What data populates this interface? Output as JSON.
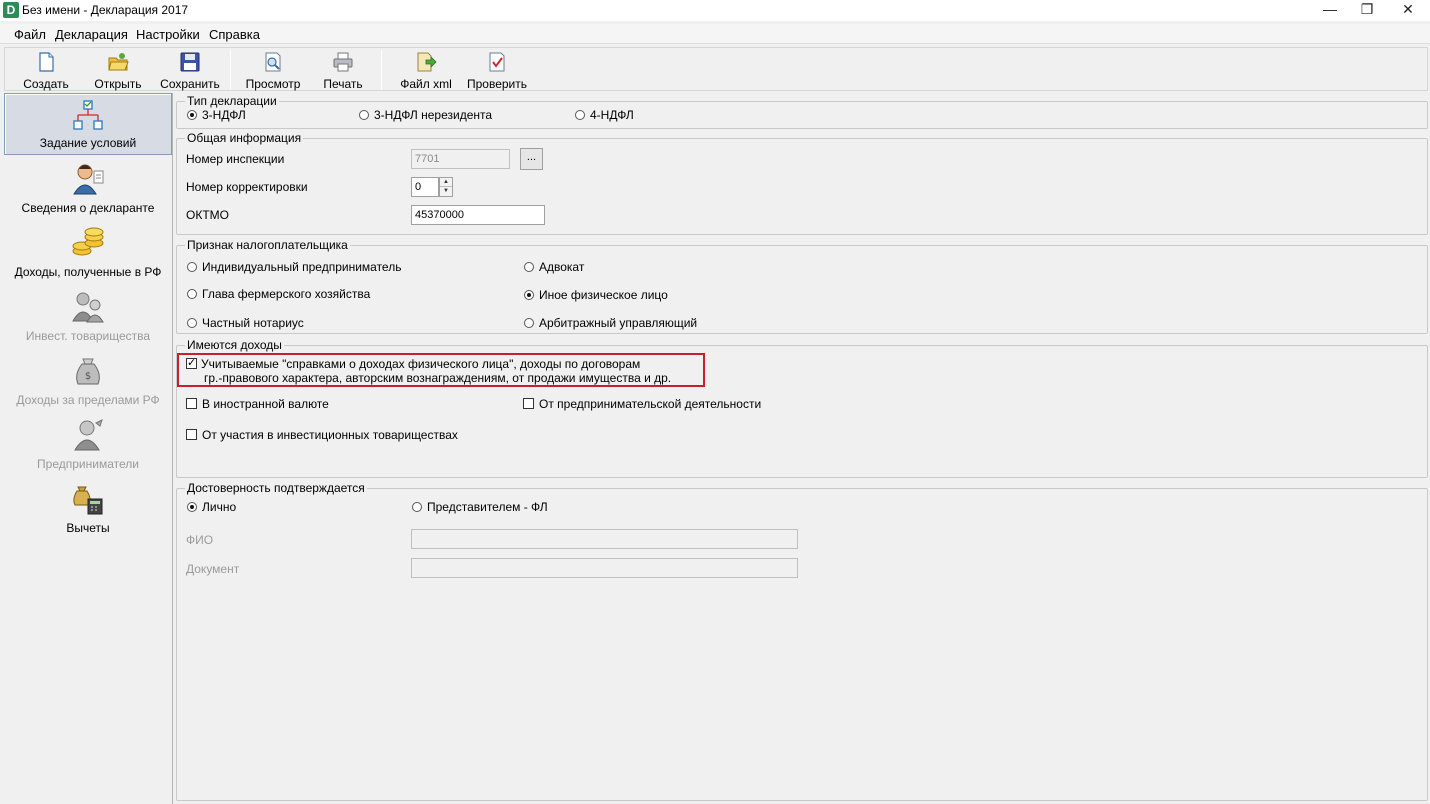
{
  "window": {
    "app_icon_letter": "D",
    "title": "Без имени - Декларация 2017",
    "controls": {
      "minimize": "—",
      "restore": "❐",
      "close": "✕"
    }
  },
  "menu": [
    "Файл",
    "Декларация",
    "Настройки",
    "Справка"
  ],
  "toolbar": [
    {
      "label": "Создать",
      "icon": "new-document-icon"
    },
    {
      "label": "Открыть",
      "icon": "open-folder-icon"
    },
    {
      "label": "Сохранить",
      "icon": "floppy-disk-icon"
    },
    {
      "label": "Просмотр",
      "icon": "preview-icon"
    },
    {
      "label": "Печать",
      "icon": "printer-icon"
    },
    {
      "label": "Файл xml",
      "icon": "xml-file-icon"
    },
    {
      "label": "Проверить",
      "icon": "check-document-icon"
    }
  ],
  "sidebar": [
    {
      "label": "Задание условий",
      "icon": "conditions-tree-icon",
      "active": true,
      "enabled": true
    },
    {
      "label": "Сведения о декларанте",
      "icon": "person-icon",
      "active": false,
      "enabled": true
    },
    {
      "label": "Доходы, полученные в РФ",
      "icon": "coins-icon",
      "active": false,
      "enabled": true
    },
    {
      "label": "Инвест. товарищества",
      "icon": "investors-icon",
      "active": false,
      "enabled": false
    },
    {
      "label": "Доходы за пределами РФ",
      "icon": "money-bag-icon",
      "active": false,
      "enabled": false
    },
    {
      "label": "Предприниматели",
      "icon": "entrepreneur-icon",
      "active": false,
      "enabled": false
    },
    {
      "label": "Вычеты",
      "icon": "deductions-icon",
      "active": false,
      "enabled": true
    }
  ],
  "declaration_type": {
    "legend": "Тип декларации",
    "options": [
      "3-НДФЛ",
      "3-НДФЛ нерезидента",
      "4-НДФЛ"
    ],
    "selected": "3-НДФЛ"
  },
  "general_info": {
    "legend": "Общая информация",
    "inspection_label": "Номер инспекции",
    "inspection_value": "7701",
    "browse_button": "...",
    "correction_label": "Номер корректировки",
    "correction_value": "0",
    "oktmo_label": "ОКТМО",
    "oktmo_value": "45370000"
  },
  "taxpayer": {
    "legend": "Признак налогоплательщика",
    "options": [
      "Индивидуальный предприниматель",
      "Адвокат",
      "Глава фермерского хозяйства",
      "Иное физическое лицо",
      "Частный нотариус",
      "Арбитражный управляющий"
    ],
    "selected": "Иное физическое лицо"
  },
  "incomes": {
    "legend": "Имеются доходы",
    "main_line1": "Учитываемые \"справками о доходах физического лица\", доходы по договорам",
    "main_line2": "гр.-правового характера, авторским вознаграждениям, от продажи имущества и др.",
    "main_checked": true,
    "foreign_currency": "В иностранной валюте",
    "entrepreneurial": "От предпринимательской деятельности",
    "investment": "От участия в инвестиционных товариществах"
  },
  "reliability": {
    "legend": "Достоверность подтверждается",
    "options": [
      "Лично",
      "Представителем - ФЛ"
    ],
    "selected": "Лично",
    "fio_label": "ФИО",
    "fio_value": "",
    "document_label": "Документ",
    "document_value": ""
  },
  "colors": {
    "highlight": "#c8202a",
    "active_sidebar": "#d7dce4",
    "disabled_text": "#9a9a9a"
  }
}
